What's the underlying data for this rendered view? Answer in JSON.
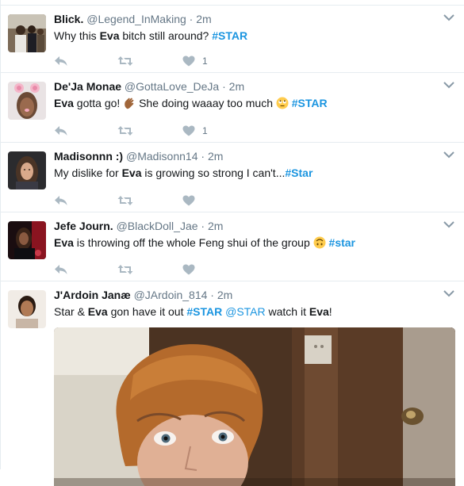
{
  "tweets": [
    {
      "name": "Blick.",
      "handle": "@Legend_InMaking",
      "time": "2m",
      "text_parts": [
        "Why this ",
        "Eva",
        " bitch still around? ",
        "#STAR"
      ],
      "likes": "1"
    },
    {
      "name": "De'Ja Monae",
      "handle": "@GottaLove_DeJa",
      "time": "2m",
      "text_parts": [
        "Eva",
        " gotta go! ",
        " She doing waaay too much ",
        " ",
        "#STAR"
      ],
      "likes": "1"
    },
    {
      "name": "Madisonnn :)",
      "handle": "@Madisonn14",
      "time": "2m",
      "text_parts": [
        "My dislike for ",
        "Eva",
        " is growing so strong I can't...",
        "#Star"
      ],
      "likes": ""
    },
    {
      "name": "Jefe Journ.",
      "handle": "@BlackDoll_Jae",
      "time": "2m",
      "text_parts": [
        "Eva",
        " is throwing off the whole Feng shui of the group ",
        " ",
        "#star"
      ],
      "likes": ""
    },
    {
      "name": "J'Ardoin Janæ",
      "handle": "@JArdoin_814",
      "time": "2m",
      "text_parts": [
        "Star & ",
        "Eva",
        " gon have it out ",
        "#STAR",
        " ",
        "@STAR",
        " watch it ",
        "Eva",
        "!"
      ]
    }
  ],
  "separator": "·",
  "colors": {
    "link": "#1b95e0",
    "meta": "#657786",
    "text": "#14171a"
  },
  "icons": [
    "reply-icon",
    "retweet-icon",
    "heart-icon",
    "chevron-down-icon",
    "clapping-hands-emoji",
    "rolling-eyes-emoji",
    "upside-down-face-emoji"
  ]
}
